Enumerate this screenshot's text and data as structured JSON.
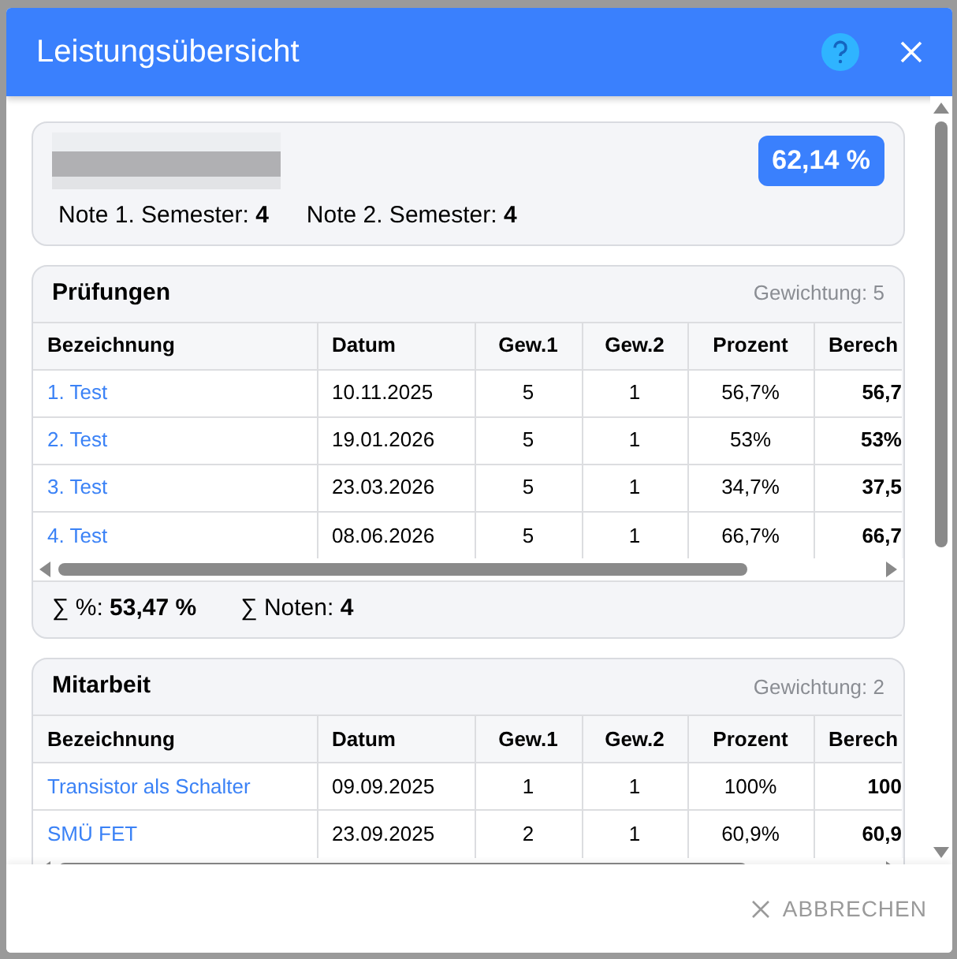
{
  "dialog": {
    "title": "Leistungsübersicht"
  },
  "summary": {
    "percent": "62,14 %",
    "grades": [
      {
        "label": "Note 1. Semester:",
        "value": "4"
      },
      {
        "label": "Note 2. Semester:",
        "value": "4"
      }
    ]
  },
  "sections": [
    {
      "title": "Prüfungen",
      "weight": "Gewichtung: 5",
      "columns": [
        "Bezeichnung",
        "Datum",
        "Gew.1",
        "Gew.2",
        "Prozent",
        "Berech"
      ],
      "rows": [
        [
          "1. Test",
          "10.11.2025",
          "5",
          "1",
          "56,7%",
          "56,7"
        ],
        [
          "2. Test",
          "19.01.2026",
          "5",
          "1",
          "53%",
          "53%"
        ],
        [
          "3. Test",
          "23.03.2026",
          "5",
          "1",
          "34,7%",
          "37,5"
        ],
        [
          "4. Test",
          "08.06.2026",
          "5",
          "1",
          "66,7%",
          "66,7"
        ]
      ],
      "footer": [
        {
          "label": "∑ %:",
          "value": "53,47 %"
        },
        {
          "label": "∑ Noten:",
          "value": "4"
        }
      ]
    },
    {
      "title": "Mitarbeit",
      "weight": "Gewichtung: 2",
      "columns": [
        "Bezeichnung",
        "Datum",
        "Gew.1",
        "Gew.2",
        "Prozent",
        "Berech"
      ],
      "rows": [
        [
          "Transistor als Schalter",
          "09.09.2025",
          "1",
          "1",
          "100%",
          "100"
        ],
        [
          "SMÜ FET",
          "23.09.2025",
          "2",
          "1",
          "60,9%",
          "60,9"
        ]
      ]
    }
  ],
  "actions": [
    {
      "label": "ABBRECHEN"
    }
  ]
}
